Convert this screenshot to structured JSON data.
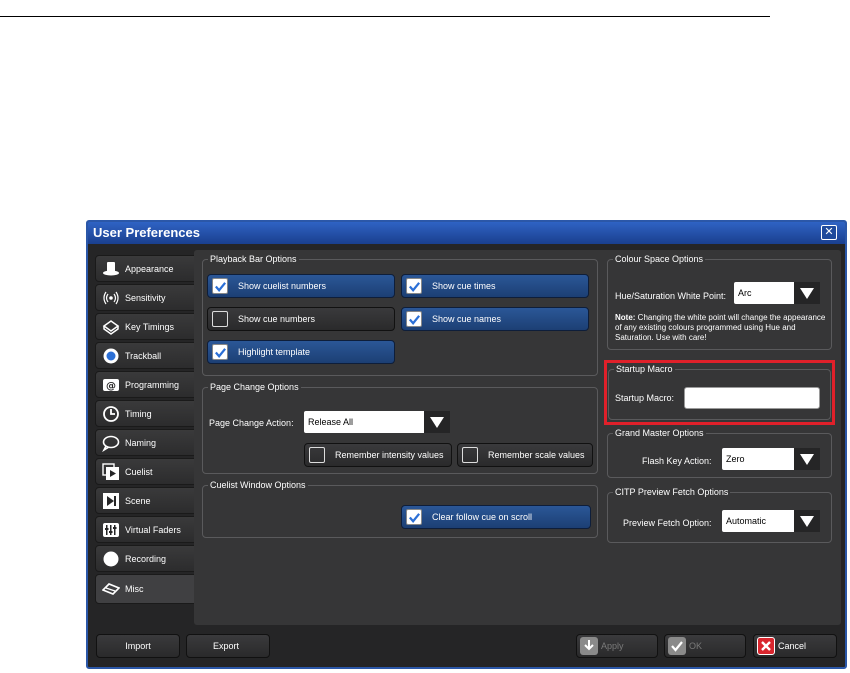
{
  "dialog": {
    "title": "User Preferences",
    "close_glyph": "✕"
  },
  "sidebar": {
    "items": [
      {
        "label": "Appearance",
        "icon": "top-hat-icon"
      },
      {
        "label": "Sensitivity",
        "icon": "signal-waves-icon"
      },
      {
        "label": "Key Timings",
        "icon": "keyboard-icon"
      },
      {
        "label": "Trackball",
        "icon": "trackball-icon"
      },
      {
        "label": "Programming",
        "icon": "programming-icon"
      },
      {
        "label": "Timing",
        "icon": "clock-icon"
      },
      {
        "label": "Naming",
        "icon": "speech-bubble-icon"
      },
      {
        "label": "Cuelist",
        "icon": "cuelist-icon"
      },
      {
        "label": "Scene",
        "icon": "scene-icon"
      },
      {
        "label": "Virtual Faders",
        "icon": "faders-icon"
      },
      {
        "label": "Recording",
        "icon": "record-dot-icon"
      },
      {
        "label": "Misc",
        "icon": "eraser-icon"
      }
    ],
    "active_index": 11
  },
  "playback": {
    "legend": "Playback Bar Options",
    "show_cuelist_numbers": {
      "label": "Show cuelist numbers",
      "checked": true
    },
    "show_cue_times": {
      "label": "Show cue times",
      "checked": true
    },
    "show_cue_numbers": {
      "label": "Show cue numbers",
      "checked": false
    },
    "show_cue_names": {
      "label": "Show cue names",
      "checked": true
    },
    "highlight_template": {
      "label": "Highlight template",
      "checked": true
    }
  },
  "page_change": {
    "legend": "Page Change Options",
    "action_label": "Page Change Action:",
    "action_value": "Release All",
    "remember_intensity": {
      "label": "Remember intensity values",
      "checked": false
    },
    "remember_scale": {
      "label": "Remember scale values",
      "checked": false
    }
  },
  "cuelist_window": {
    "legend": "Cuelist Window Options",
    "clear_follow": {
      "label": "Clear follow cue on scroll",
      "checked": true
    }
  },
  "colour_space": {
    "legend": "Colour Space Options",
    "white_point_label": "Hue/Saturation White Point:",
    "white_point_value": "Arc",
    "note_bold": "Note:",
    "note_text": " Changing the white point will change the appearance of any existing colours programmed using Hue and Saturation. Use with care!"
  },
  "startup_macro": {
    "legend": "Startup Macro",
    "label": "Startup Macro:",
    "value": ""
  },
  "grand_master": {
    "legend": "Grand Master Options",
    "label": "Flash Key Action:",
    "value": "Zero"
  },
  "citp": {
    "legend": "CITP Preview Fetch Options",
    "label": "Preview Fetch Option:",
    "value": "Automatic"
  },
  "buttons": {
    "import": "Import",
    "export": "Export",
    "apply": "Apply",
    "ok": "OK",
    "cancel": "Cancel"
  },
  "colors": {
    "accent": "#2b57a8",
    "highlight_border": "#e0202a",
    "cancel_red": "#d9262e"
  }
}
